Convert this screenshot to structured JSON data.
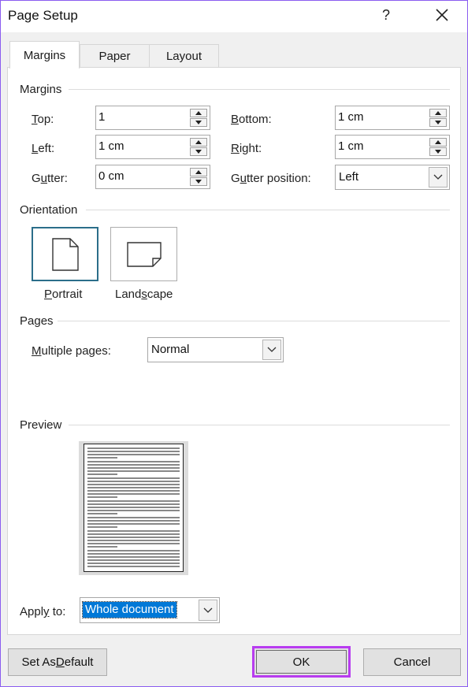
{
  "window": {
    "title": "Page Setup",
    "help_glyph": "?"
  },
  "tabs": [
    {
      "label": "Margins"
    },
    {
      "label": "Paper"
    },
    {
      "label": "Layout"
    }
  ],
  "margins": {
    "section": "Margins",
    "top": {
      "label_key": "T",
      "label_rest": "op:",
      "value": "1"
    },
    "left": {
      "label_key": "L",
      "label_rest": "eft:",
      "value": "1 cm"
    },
    "gutter": {
      "label_pre": "G",
      "label_key": "u",
      "label_rest": "tter:",
      "value": "0 cm"
    },
    "bottom": {
      "label_key": "B",
      "label_rest": "ottom:",
      "value": "1 cm"
    },
    "right": {
      "label_key": "R",
      "label_rest": "ight:",
      "value": "1 cm"
    },
    "gutter_position": {
      "label_pre": "G",
      "label_key": "u",
      "label_rest": "tter position:",
      "value": "Left"
    }
  },
  "orientation": {
    "section": "Orientation",
    "portrait": {
      "label_key": "P",
      "label_rest": "ortrait"
    },
    "landscape": {
      "label_pre": "Land",
      "label_key": "s",
      "label_rest": "cape"
    }
  },
  "pages": {
    "section": "Pages",
    "multiple": {
      "label_key": "M",
      "label_rest": "ultiple pages:",
      "value": "Normal"
    }
  },
  "preview": {
    "section": "Preview"
  },
  "apply_to": {
    "label_pre": "Appl",
    "label_key": "y",
    "label_rest": " to:",
    "value": "Whole document"
  },
  "buttons": {
    "set_default": {
      "label_pre": "Set As ",
      "label_key": "D",
      "label_rest": "efault"
    },
    "ok": "OK",
    "cancel": "Cancel"
  },
  "colors": {
    "accent_highlight": "#b83cf0",
    "selection": "#0078d7",
    "window_border": "#8a5cf0"
  }
}
